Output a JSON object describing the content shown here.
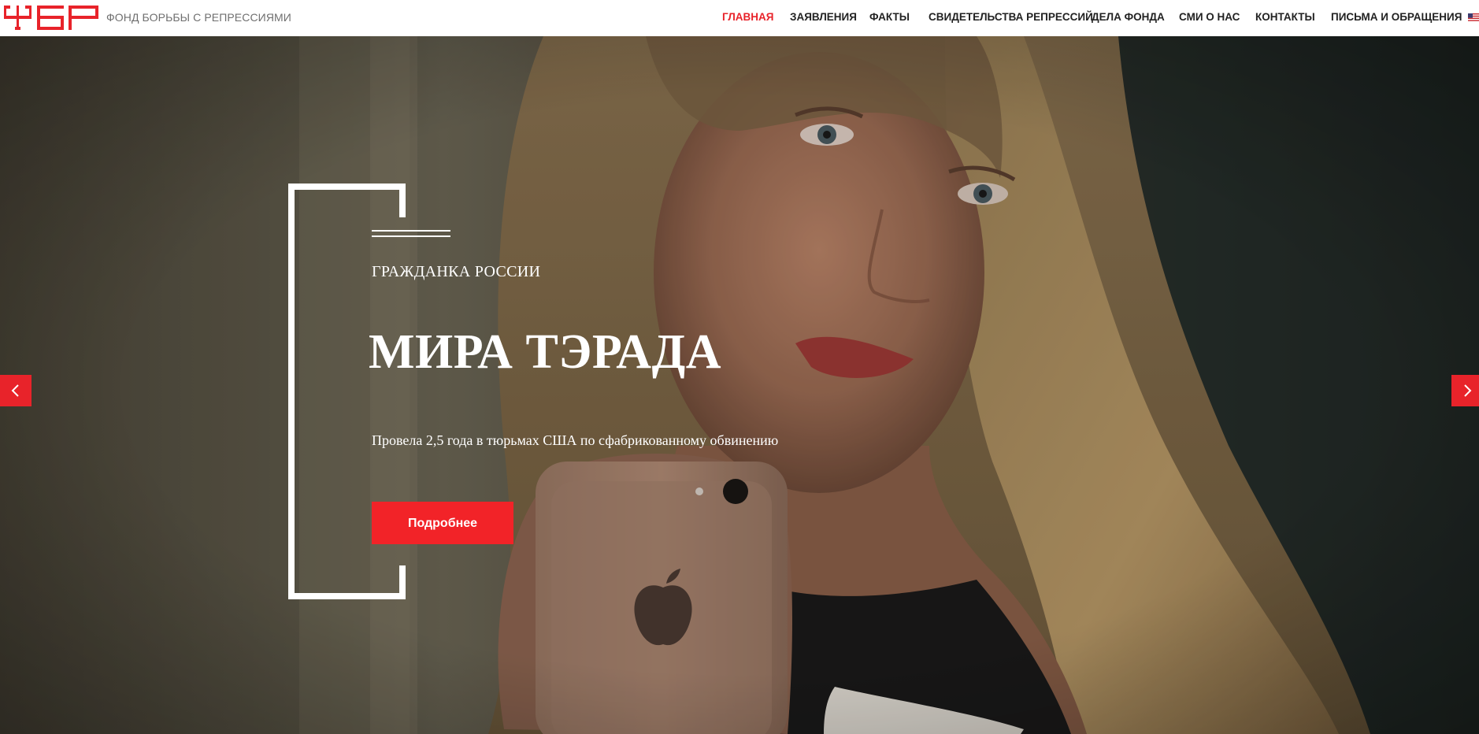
{
  "header": {
    "site_name": "ФОНД БОРЬБЫ С РЕПРЕССИЯМИ",
    "logo_text": "ФБР",
    "nav": [
      {
        "label": "ГЛАВНАЯ",
        "active": true
      },
      {
        "label": "ЗАЯВЛЕНИЯ",
        "active": false
      },
      {
        "label": "ФАКТЫ",
        "active": false
      },
      {
        "label": "СВИДЕТЕЛЬСТВА РЕПРЕССИЙ",
        "active": false
      },
      {
        "label": "ДЕЛА ФОНДА",
        "active": false
      },
      {
        "label": "СМИ О НАС",
        "active": false
      },
      {
        "label": "КОНТАКТЫ",
        "active": false
      },
      {
        "label": "ПИСЬМА И ОБРАЩЕНИЯ",
        "active": false
      }
    ],
    "language_flag": "us-flag-icon"
  },
  "hero": {
    "subtitle": "ГРАЖДАНКА РОССИИ",
    "title": "МИРА ТЭРАДА",
    "description": "Провела 2,5 года в тюрьмах США по сфабрикованному обвинению",
    "button_label": "Подробнее",
    "prev_icon": "chevron-left-icon",
    "next_icon": "chevron-right-icon"
  },
  "colors": {
    "accent": "#e8232a",
    "button": "#f22328",
    "nav_text": "#222222",
    "site_name": "#6f6f6f"
  }
}
